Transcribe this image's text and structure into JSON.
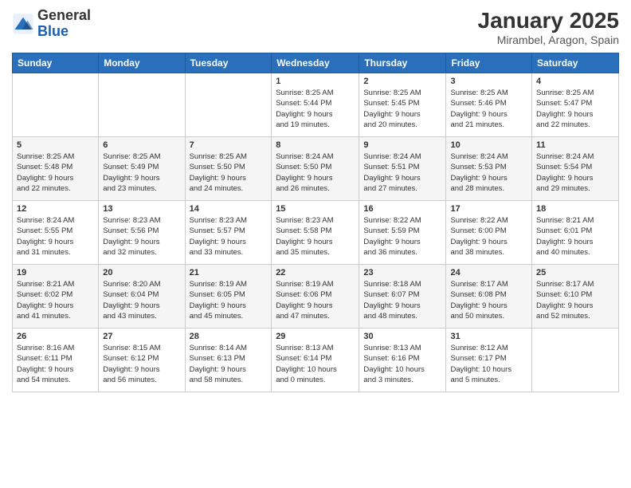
{
  "header": {
    "logo_general": "General",
    "logo_blue": "Blue",
    "title": "January 2025",
    "subtitle": "Mirambel, Aragon, Spain"
  },
  "days_of_week": [
    "Sunday",
    "Monday",
    "Tuesday",
    "Wednesday",
    "Thursday",
    "Friday",
    "Saturday"
  ],
  "weeks": [
    {
      "cells": [
        {
          "day": "",
          "info": ""
        },
        {
          "day": "",
          "info": ""
        },
        {
          "day": "",
          "info": ""
        },
        {
          "day": "1",
          "info": "Sunrise: 8:25 AM\nSunset: 5:44 PM\nDaylight: 9 hours\nand 19 minutes."
        },
        {
          "day": "2",
          "info": "Sunrise: 8:25 AM\nSunset: 5:45 PM\nDaylight: 9 hours\nand 20 minutes."
        },
        {
          "day": "3",
          "info": "Sunrise: 8:25 AM\nSunset: 5:46 PM\nDaylight: 9 hours\nand 21 minutes."
        },
        {
          "day": "4",
          "info": "Sunrise: 8:25 AM\nSunset: 5:47 PM\nDaylight: 9 hours\nand 22 minutes."
        }
      ]
    },
    {
      "cells": [
        {
          "day": "5",
          "info": "Sunrise: 8:25 AM\nSunset: 5:48 PM\nDaylight: 9 hours\nand 22 minutes."
        },
        {
          "day": "6",
          "info": "Sunrise: 8:25 AM\nSunset: 5:49 PM\nDaylight: 9 hours\nand 23 minutes."
        },
        {
          "day": "7",
          "info": "Sunrise: 8:25 AM\nSunset: 5:50 PM\nDaylight: 9 hours\nand 24 minutes."
        },
        {
          "day": "8",
          "info": "Sunrise: 8:24 AM\nSunset: 5:50 PM\nDaylight: 9 hours\nand 26 minutes."
        },
        {
          "day": "9",
          "info": "Sunrise: 8:24 AM\nSunset: 5:51 PM\nDaylight: 9 hours\nand 27 minutes."
        },
        {
          "day": "10",
          "info": "Sunrise: 8:24 AM\nSunset: 5:53 PM\nDaylight: 9 hours\nand 28 minutes."
        },
        {
          "day": "11",
          "info": "Sunrise: 8:24 AM\nSunset: 5:54 PM\nDaylight: 9 hours\nand 29 minutes."
        }
      ]
    },
    {
      "cells": [
        {
          "day": "12",
          "info": "Sunrise: 8:24 AM\nSunset: 5:55 PM\nDaylight: 9 hours\nand 31 minutes."
        },
        {
          "day": "13",
          "info": "Sunrise: 8:23 AM\nSunset: 5:56 PM\nDaylight: 9 hours\nand 32 minutes."
        },
        {
          "day": "14",
          "info": "Sunrise: 8:23 AM\nSunset: 5:57 PM\nDaylight: 9 hours\nand 33 minutes."
        },
        {
          "day": "15",
          "info": "Sunrise: 8:23 AM\nSunset: 5:58 PM\nDaylight: 9 hours\nand 35 minutes."
        },
        {
          "day": "16",
          "info": "Sunrise: 8:22 AM\nSunset: 5:59 PM\nDaylight: 9 hours\nand 36 minutes."
        },
        {
          "day": "17",
          "info": "Sunrise: 8:22 AM\nSunset: 6:00 PM\nDaylight: 9 hours\nand 38 minutes."
        },
        {
          "day": "18",
          "info": "Sunrise: 8:21 AM\nSunset: 6:01 PM\nDaylight: 9 hours\nand 40 minutes."
        }
      ]
    },
    {
      "cells": [
        {
          "day": "19",
          "info": "Sunrise: 8:21 AM\nSunset: 6:02 PM\nDaylight: 9 hours\nand 41 minutes."
        },
        {
          "day": "20",
          "info": "Sunrise: 8:20 AM\nSunset: 6:04 PM\nDaylight: 9 hours\nand 43 minutes."
        },
        {
          "day": "21",
          "info": "Sunrise: 8:19 AM\nSunset: 6:05 PM\nDaylight: 9 hours\nand 45 minutes."
        },
        {
          "day": "22",
          "info": "Sunrise: 8:19 AM\nSunset: 6:06 PM\nDaylight: 9 hours\nand 47 minutes."
        },
        {
          "day": "23",
          "info": "Sunrise: 8:18 AM\nSunset: 6:07 PM\nDaylight: 9 hours\nand 48 minutes."
        },
        {
          "day": "24",
          "info": "Sunrise: 8:17 AM\nSunset: 6:08 PM\nDaylight: 9 hours\nand 50 minutes."
        },
        {
          "day": "25",
          "info": "Sunrise: 8:17 AM\nSunset: 6:10 PM\nDaylight: 9 hours\nand 52 minutes."
        }
      ]
    },
    {
      "cells": [
        {
          "day": "26",
          "info": "Sunrise: 8:16 AM\nSunset: 6:11 PM\nDaylight: 9 hours\nand 54 minutes."
        },
        {
          "day": "27",
          "info": "Sunrise: 8:15 AM\nSunset: 6:12 PM\nDaylight: 9 hours\nand 56 minutes."
        },
        {
          "day": "28",
          "info": "Sunrise: 8:14 AM\nSunset: 6:13 PM\nDaylight: 9 hours\nand 58 minutes."
        },
        {
          "day": "29",
          "info": "Sunrise: 8:13 AM\nSunset: 6:14 PM\nDaylight: 10 hours\nand 0 minutes."
        },
        {
          "day": "30",
          "info": "Sunrise: 8:13 AM\nSunset: 6:16 PM\nDaylight: 10 hours\nand 3 minutes."
        },
        {
          "day": "31",
          "info": "Sunrise: 8:12 AM\nSunset: 6:17 PM\nDaylight: 10 hours\nand 5 minutes."
        },
        {
          "day": "",
          "info": ""
        }
      ]
    }
  ]
}
